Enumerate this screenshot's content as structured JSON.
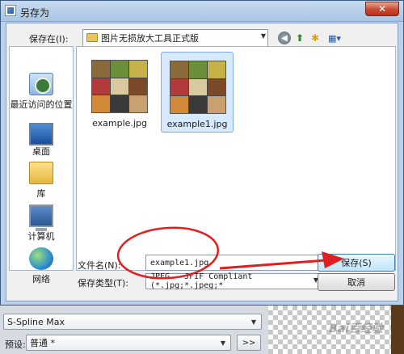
{
  "dialog": {
    "title": "另存为",
    "close_symbol": "✕"
  },
  "toolbar": {
    "save_in_label": "保存在(I):",
    "current_folder": "图片无损放大工具正式版",
    "back_icon": "◀",
    "up_icon": "⬆",
    "new_folder_icon": "✱",
    "views_icon": "▦▾"
  },
  "places": [
    {
      "label": "最近访问的位置",
      "icon": "recent-places-icon"
    },
    {
      "label": "桌面",
      "icon": "desktop-icon"
    },
    {
      "label": "库",
      "icon": "library-icon"
    },
    {
      "label": "计算机",
      "icon": "computer-icon"
    },
    {
      "label": "网络",
      "icon": "network-icon"
    }
  ],
  "files": [
    {
      "name": "example.jpg",
      "selected": false
    },
    {
      "name": "example1.jpg",
      "selected": true
    }
  ],
  "thumb_colors": [
    "#8a6a3a",
    "#6d8f3a",
    "#c7b24a",
    "#b23a3a",
    "#d9c9a0",
    "#7a4a2a",
    "#d18a3a",
    "#3a3a3a",
    "#c9a070"
  ],
  "form": {
    "filename_label": "文件名(N):",
    "filename_value": "example1.jpg",
    "filetype_label": "保存类型(T):",
    "filetype_value": "JPEG - JFIF Compliant (*.jpg;*.jpeg;*",
    "save_button": "保存(S)",
    "cancel_button": "取消"
  },
  "background_app": {
    "algorithm_value": "S-Spline Max",
    "preset_label": "预设:",
    "preset_value": "普通 *",
    "more_button": ">>"
  },
  "watermark": "Bai百经验",
  "colors": {
    "annotation_red": "#e02020",
    "selection_fill": "#d7e9fc",
    "dialog_frame": "#b9d1ea"
  }
}
